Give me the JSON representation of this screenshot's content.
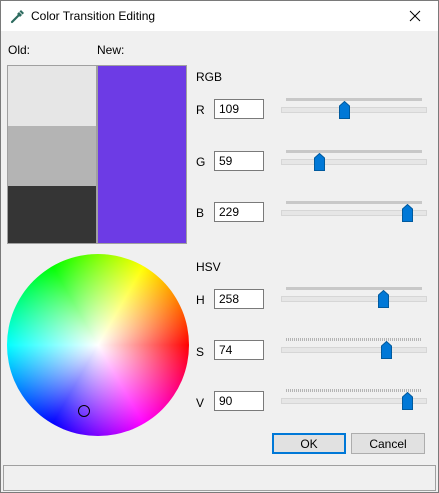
{
  "window": {
    "title": "Color Transition Editing"
  },
  "labels": {
    "old": "Old:",
    "new": "New:",
    "rgb": "RGB",
    "hsv": "HSV"
  },
  "swatches": {
    "old_colors": [
      "#e6e6e6",
      "#b4b4b4",
      "#353535"
    ],
    "new_color": "#6d3be5"
  },
  "channels": {
    "r": {
      "label": "R",
      "value": "109",
      "max": 255
    },
    "g": {
      "label": "G",
      "value": "59",
      "max": 255
    },
    "b": {
      "label": "B",
      "value": "229",
      "max": 255
    },
    "h": {
      "label": "H",
      "value": "258",
      "max": 360
    },
    "s": {
      "label": "S",
      "value": "74",
      "max": 100
    },
    "v": {
      "label": "V",
      "value": "90",
      "max": 100
    }
  },
  "buttons": {
    "ok": "OK",
    "cancel": "Cancel"
  },
  "colors": {
    "accent": "#0078d7"
  }
}
